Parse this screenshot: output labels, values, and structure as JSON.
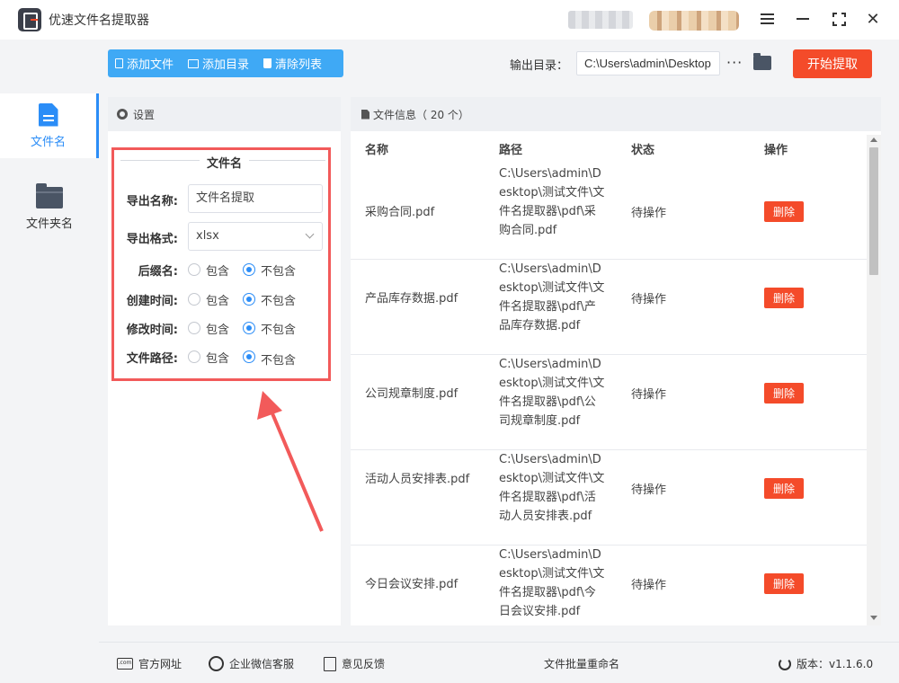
{
  "app": {
    "title": "优速文件名提取器"
  },
  "nav": [
    {
      "label": "文件名",
      "icon": "file-icon",
      "active": true
    },
    {
      "label": "文件夹名",
      "icon": "folder-icon",
      "active": false
    }
  ],
  "toolbar": {
    "add_file": "添加文件",
    "add_dir": "添加目录",
    "clear_list": "清除列表",
    "output_label": "输出目录：",
    "output_value": "C:\\Users\\admin\\Desktop",
    "more": "···",
    "start": "开始提取"
  },
  "settings": {
    "header": "设置",
    "section_title": "文件名",
    "export_name_label": "导出名称:",
    "export_name_value": "文件名提取",
    "export_format_label": "导出格式:",
    "export_format_value": "xlsx",
    "options": [
      {
        "label": "后缀名:",
        "include": "包含",
        "exclude": "不包含",
        "selected": "exclude"
      },
      {
        "label": "创建时间:",
        "include": "包含",
        "exclude": "不包含",
        "selected": "exclude"
      },
      {
        "label": "修改时间:",
        "include": "包含",
        "exclude": "不包含",
        "selected": "exclude"
      },
      {
        "label": "文件路径:",
        "include": "包含",
        "exclude": "不包含",
        "selected": "exclude"
      }
    ]
  },
  "filelist": {
    "header": "文件信息（ 20 个）",
    "columns": [
      "名称",
      "路径",
      "状态",
      "操作"
    ],
    "rows": [
      {
        "name": "采购合同.pdf",
        "path": "C:\\Users\\admin\\Desktop\\测试文件\\文件名提取器\\pdf\\采购合同.pdf",
        "status": "待操作",
        "action": "删除"
      },
      {
        "name": "产品库存数据.pdf",
        "path": "C:\\Users\\admin\\Desktop\\测试文件\\文件名提取器\\pdf\\产品库存数据.pdf",
        "status": "待操作",
        "action": "删除"
      },
      {
        "name": "公司规章制度.pdf",
        "path": "C:\\Users\\admin\\Desktop\\测试文件\\文件名提取器\\pdf\\公司规章制度.pdf",
        "status": "待操作",
        "action": "删除"
      },
      {
        "name": "活动人员安排表.pdf",
        "path": "C:\\Users\\admin\\Desktop\\测试文件\\文件名提取器\\pdf\\活动人员安排表.pdf",
        "status": "待操作",
        "action": "删除"
      },
      {
        "name": "今日会议安排.pdf",
        "path": "C:\\Users\\admin\\Desktop\\测试文件\\文件名提取器\\pdf\\今日会议安排.pdf",
        "status": "待操作",
        "action": "删除"
      }
    ]
  },
  "footer": {
    "website": "官方网址",
    "wechat": "企业微信客服",
    "feedback": "意见反馈",
    "batch_rename": "文件批量重命名",
    "version": "版本：v1.1.6.0"
  },
  "colors": {
    "accent_blue": "#2b8df7",
    "toolbar_blue": "#3fa9f5",
    "action_red": "#f44b2a",
    "highlight_red": "#f25a5a"
  }
}
